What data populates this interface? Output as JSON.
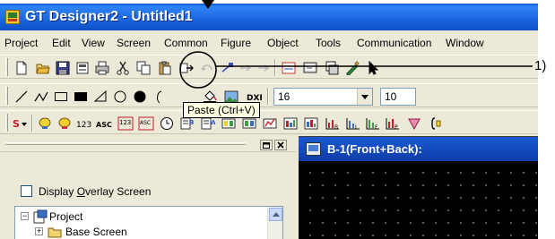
{
  "window": {
    "title": "GT Designer2 - Untitled1"
  },
  "menu": [
    "Project",
    "Edit",
    "View",
    "Screen",
    "Common",
    "Figure",
    "Object",
    "Tools",
    "Communication",
    "Window"
  ],
  "toolbar_main": {
    "icons": [
      "new-icon",
      "open-icon",
      "save-icon",
      "print-preview-icon",
      "print-icon",
      "cut-icon",
      "copy-icon",
      "paste-icon",
      "transfer-icon",
      "undo-icon",
      "redo-icon",
      "arrow-icon",
      "arrow-icon",
      "edit-icon",
      "screen-icon",
      "pen-icon",
      "select-pointer-icon"
    ]
  },
  "toolbar_draw": {
    "icons": [
      "line-icon",
      "polyline-icon",
      "rectangle-icon",
      "filled-rectangle-icon",
      "triangle-icon",
      "circle-icon",
      "filled-circle-icon",
      "arc-icon",
      "fill-icon",
      "image-icon",
      "dxf-icon"
    ],
    "line_width": "16",
    "second_value": "10"
  },
  "toolbar_objects": {
    "icons": [
      "switch-icon",
      "lamp-icon",
      "lamp-icon",
      "numeric-display-icon",
      "ascii-display-icon",
      "numeric-input-icon",
      "ascii-input-icon",
      "clock-icon",
      "comment-icon",
      "alarm-icon",
      "history-icon",
      "parts-icon",
      "graph-icon",
      "trend-icon",
      "bar-graph-icon",
      "statistics-icon",
      "scatter-icon",
      "scatter-icon",
      "scatter-icon",
      "level-icon",
      "bracket-icon"
    ]
  },
  "tooltip": "Paste (Ctrl+V)",
  "left_pane": {
    "overlay_checkbox": "Display Overlay Screen",
    "tree": [
      {
        "label": "Project"
      },
      {
        "label": "Base Screen"
      }
    ]
  },
  "screen_window": {
    "title": "B-1(Front+Back):"
  },
  "annotation": {
    "label": "1)"
  },
  "colors": {
    "title_bar": "#1a66e0",
    "tooltip_bg": "#ffffe1",
    "screen_bg": "#000000",
    "workspace": "#ece9d8"
  }
}
